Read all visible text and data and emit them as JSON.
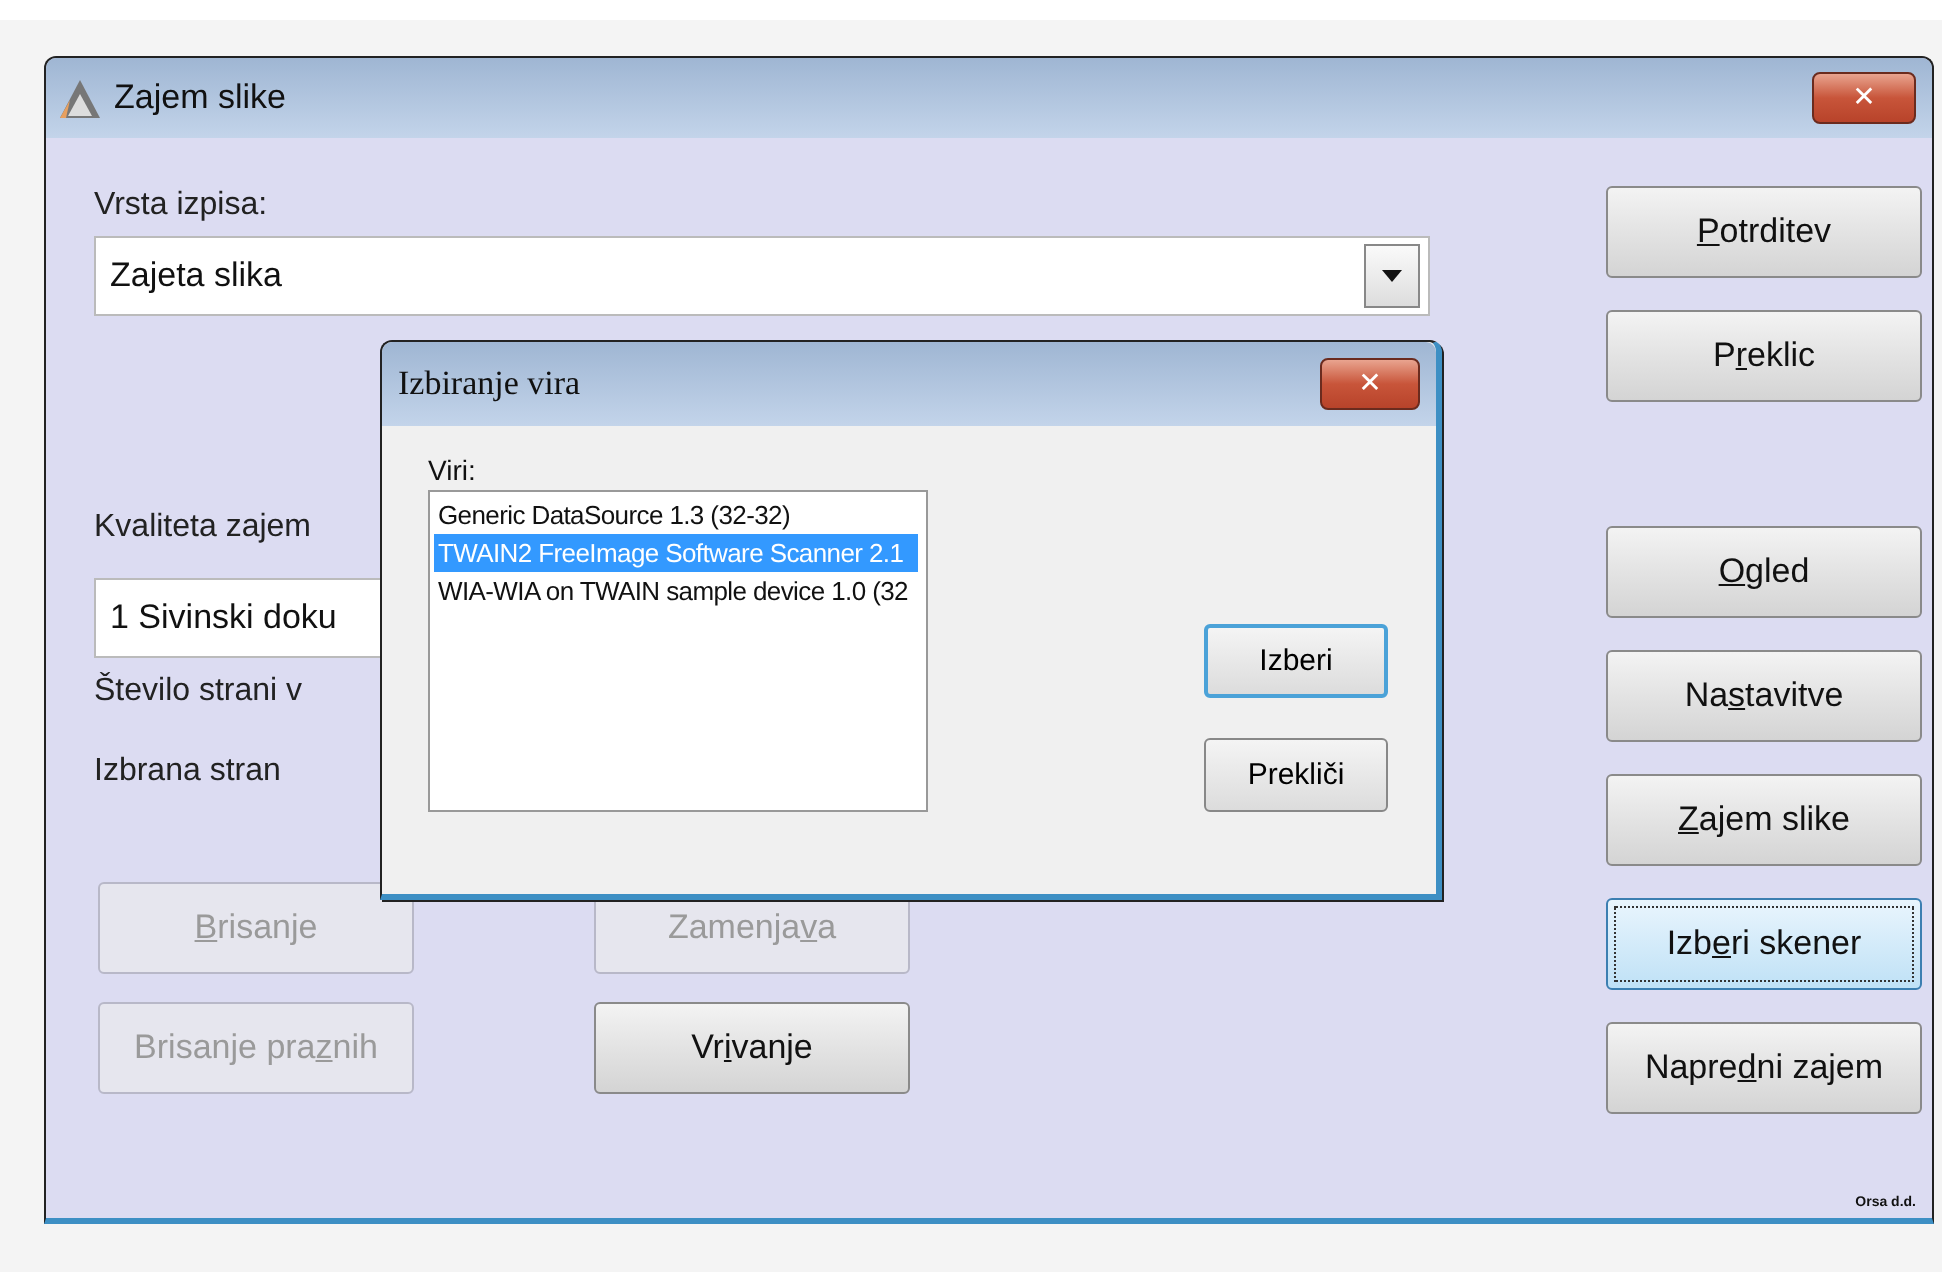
{
  "window": {
    "title": "Zajem slike",
    "close": "✕"
  },
  "output_type": {
    "label": "Vrsta izpisa:",
    "value": "Zajeta slika"
  },
  "quality": {
    "label": "Kvaliteta zajem",
    "value": "1 Sivinski doku"
  },
  "page_count": {
    "label": "Število strani v"
  },
  "selected_page": {
    "label": "Izbrana stran"
  },
  "page_buttons": [
    {
      "key": "B",
      "after": "risanje",
      "disabled": true
    },
    {
      "before": "Zamenja",
      "key": "v",
      "after": "a",
      "disabled": true
    },
    {
      "before": "Brisanje pra",
      "key": "z",
      "after": "nih",
      "disabled": true
    },
    {
      "before": "Vr",
      "key": "i",
      "after": "vanje",
      "disabled": false
    }
  ],
  "confirm_buttons": [
    {
      "key": "P",
      "after": "otrditev",
      "focused": false
    },
    {
      "before": "P",
      "key": "r",
      "after": "eklic",
      "focused": false
    }
  ],
  "scan_buttons": [
    {
      "key": "O",
      "after": "gled",
      "focused": false
    },
    {
      "before": "Na",
      "key": "s",
      "after": "tavitve",
      "focused": false
    },
    {
      "key": "Z",
      "after": "ajem slike",
      "focused": false
    },
    {
      "before": "Izb",
      "key": "e",
      "after": "ri skener",
      "focused": true
    },
    {
      "before": "Napre",
      "key": "d",
      "after": "ni zajem",
      "focused": false
    }
  ],
  "footer_mark": "Orsa d.d.",
  "source_dialog": {
    "title": "Izbiranje vira",
    "close": "✕",
    "list_label": "Viri:",
    "sources": [
      {
        "name": "Generic DataSource 1.3 (32-32)",
        "selected": false
      },
      {
        "name": "TWAIN2 FreeImage Software Scanner 2.1",
        "selected": true
      },
      {
        "name": "WIA-WIA on TWAIN sample device 1.0 (32",
        "selected": false
      }
    ],
    "buttons": [
      {
        "label": "Izberi",
        "default": true
      },
      {
        "label": "Prekliči",
        "default": false
      }
    ]
  }
}
